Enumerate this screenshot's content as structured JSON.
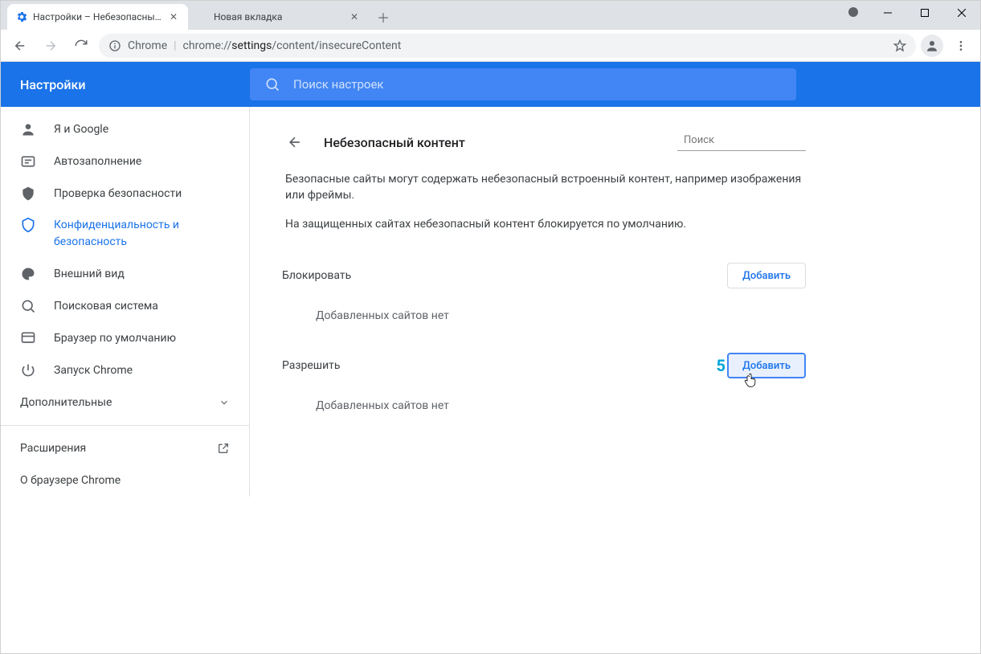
{
  "window": {
    "tabs": [
      {
        "title": "Настройки – Небезопасный контент",
        "active": true
      },
      {
        "title": "Новая вкладка",
        "active": false
      }
    ]
  },
  "addressbar": {
    "prefix": "Chrome",
    "url": "chrome://settings/content/insecureContent"
  },
  "header": {
    "title": "Настройки",
    "search_placeholder": "Поиск настроек"
  },
  "sidebar": {
    "items": [
      {
        "label": "Я и Google",
        "icon": "person"
      },
      {
        "label": "Автозаполнение",
        "icon": "autofill"
      },
      {
        "label": "Проверка безопасности",
        "icon": "shield-check"
      },
      {
        "label": "Конфиденциальность и безопасность",
        "icon": "shield",
        "active": true
      },
      {
        "label": "Внешний вид",
        "icon": "palette"
      },
      {
        "label": "Поисковая система",
        "icon": "search"
      },
      {
        "label": "Браузер по умолчанию",
        "icon": "browser"
      },
      {
        "label": "Запуск Chrome",
        "icon": "power"
      }
    ],
    "advanced": "Дополнительные",
    "extensions": "Расширения",
    "about": "О браузере Chrome"
  },
  "page": {
    "title": "Небезопасный контент",
    "search_placeholder": "Поиск",
    "desc1": "Безопасные сайты могут содержать небезопасный встроенный контент, например изображения или фреймы.",
    "desc2": "На защищенных сайтах небезопасный контент блокируется по умолчанию.",
    "block": {
      "label": "Блокировать",
      "add": "Добавить",
      "empty": "Добавленных сайтов нет"
    },
    "allow": {
      "label": "Разрешить",
      "add": "Добавить",
      "empty": "Добавленных сайтов нет",
      "callout": "5"
    }
  }
}
